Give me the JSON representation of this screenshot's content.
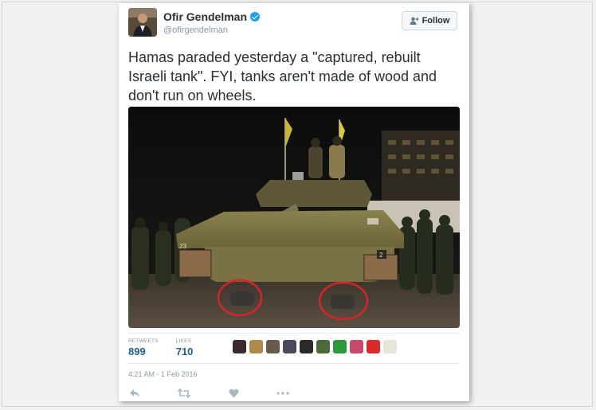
{
  "tweet": {
    "author_name": "Ofir Gendelman",
    "handle": "@ofirgendelman",
    "follow_label": "Follow",
    "text_lines": [
      "Hamas paraded yesterday a \"captured, rebuilt",
      "Israeli tank\". FYI, tanks aren't made of wood and",
      "don't run on wheels."
    ],
    "stats": {
      "retweets_label": "RETWEETS",
      "retweets": "899",
      "likes_label": "LIKES",
      "likes": "710"
    },
    "timestamp": "4:21 AM - 1 Feb 2016",
    "tank_markings": {
      "number_left": "23",
      "number_right": "2"
    }
  },
  "icons": {
    "verified": "verified-badge-icon",
    "follow": "add-user-icon",
    "actions": [
      "reply-icon",
      "retweet-icon",
      "like-icon",
      "more-icon"
    ]
  },
  "colors": {
    "link_blue": "#1b5e99",
    "verified_blue": "#1da1f2",
    "circle_red": "#d8232a",
    "meta_gray": "#8899a6"
  }
}
